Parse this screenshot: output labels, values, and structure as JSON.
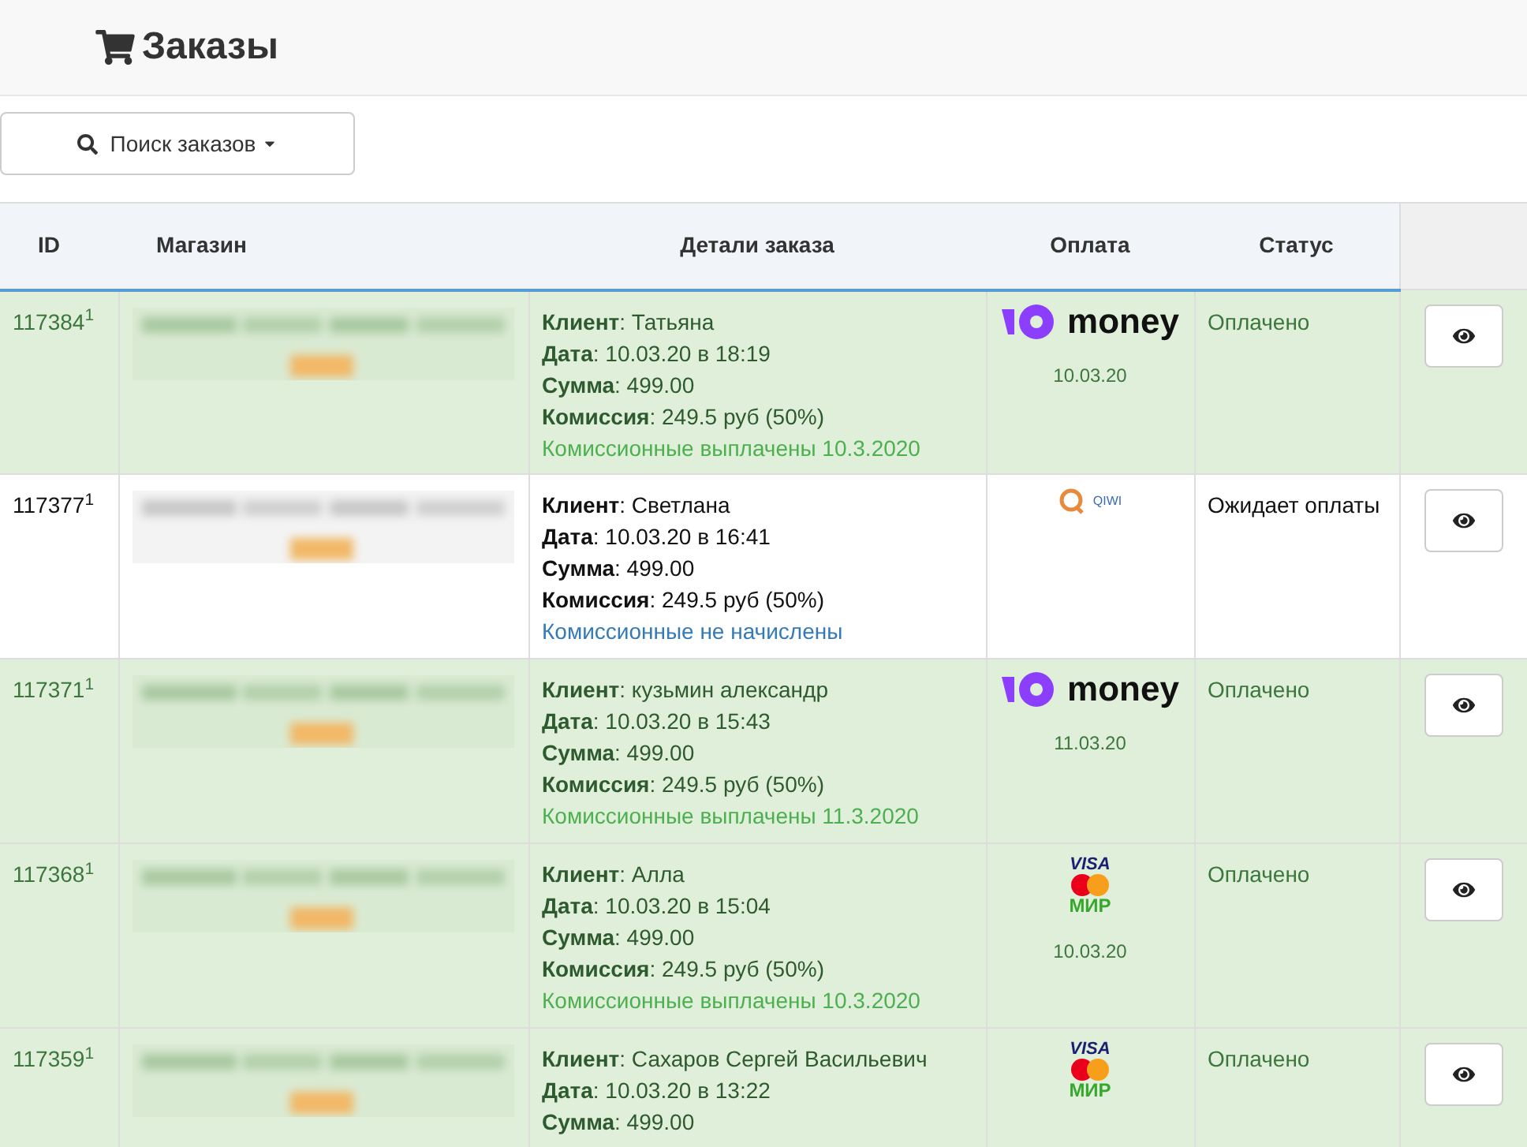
{
  "page_title": "Заказы",
  "search_button": "Поиск заказов",
  "table": {
    "columns": [
      "ID",
      "Магазин",
      "Детали заказа",
      "Оплата",
      "Статус"
    ],
    "rows": [
      {
        "id": "117384$^{1}$",
        "paid": true,
        "shop": {
          "kind": "picture"
        },
        "details": [
          "**Клиент**: Татьяна",
          "**Дата**: 10.03.20 в 18:19",
          "**Сумма**: 499.00",
          "**Комиссия**: 249.5 руб (50%)"
        ],
        "note": "Комиссионные выплачены 10.3.2020",
        "payment": {
          "kind": "yoomoney",
          "logo_texts": [
            "money"
          ],
          "date": "10.03.20"
        },
        "status": "Оплачено"
      },
      {
        "id": "117377$^{1}$",
        "paid": false,
        "shop": {
          "kind": "picture"
        },
        "details": [
          "**Клиент**: Светлана",
          "**Дата**: 10.03.20 в 16:41",
          "**Сумма**: 499.00",
          "**Комиссия**: 249.5 руб (50%)"
        ],
        "note": "Комиссионные не начислены",
        "payment": {
          "kind": "qiwi",
          "logo_texts": [
            "QIWI"
          ]
        },
        "status": "Ожидает оплаты"
      },
      {
        "id": "117371$^{1}$",
        "paid": true,
        "shop": {
          "kind": "picture"
        },
        "details": [
          "**Клиент**: кузьмин александр",
          "**Дата**: 10.03.20 в 15:43",
          "**Сумма**: 499.00",
          "**Комиссия**: 249.5 руб (50%)"
        ],
        "note": "Комиссионные выплачены 11.3.2020",
        "payment": {
          "kind": "yoomoney",
          "logo_texts": [
            "money"
          ],
          "date": "11.03.20"
        },
        "status": "Оплачено"
      },
      {
        "id": "117368$^{1}$",
        "paid": true,
        "shop": {
          "kind": "picture"
        },
        "details": [
          "**Клиент**: Алла",
          "**Дата**: 10.03.20 в 15:04",
          "**Сумма**: 499.00",
          "**Комиссия**: 249.5 руб (50%)"
        ],
        "note": "Комиссионные выплачены 10.3.2020",
        "payment": {
          "kind": "cards",
          "logo_texts": [
            "VISA",
            "МИР"
          ],
          "date": "10.03.20"
        },
        "status": "Оплачено"
      },
      {
        "id": "117359$^{1}$",
        "paid": true,
        "shop": {
          "kind": "picture"
        },
        "details": [
          "**Клиент**: Сахаров Сергей Васильевич",
          "**Дата**: 10.03.20 в 13:22",
          "**Сумма**: 499.00"
        ],
        "payment": {
          "kind": "cards",
          "logo_texts": [
            "VISA",
            "МИР"
          ]
        },
        "status": "Оплачено"
      }
    ]
  }
}
